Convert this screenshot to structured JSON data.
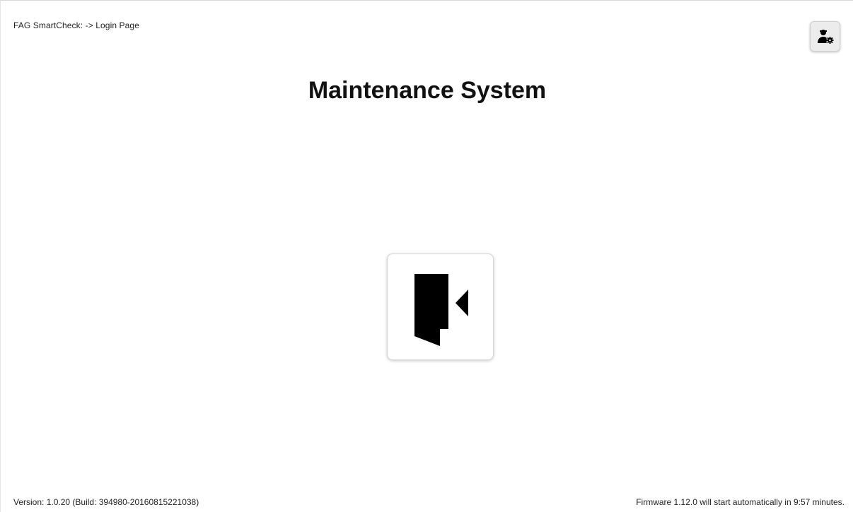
{
  "header": {
    "breadcrumb": "FAG SmartCheck: -> Login Page"
  },
  "main": {
    "title": "Maintenance System"
  },
  "icons": {
    "user_settings": "user-gear-icon",
    "login": "door-enter-icon"
  },
  "footer": {
    "version": "Version: 1.0.20 (Build: 394980-20160815221038)",
    "firmware": "Firmware 1.12.0 will start automatically in 9:57 minutes."
  },
  "colors": {
    "background": "#ffffff",
    "text": "#111111",
    "icon": "#000000"
  }
}
